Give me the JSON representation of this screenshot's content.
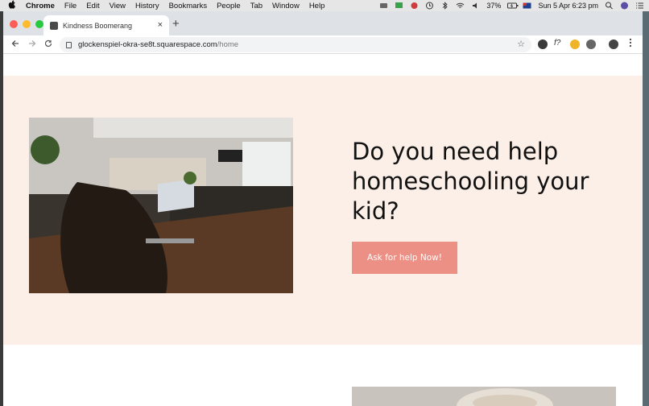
{
  "menubar": {
    "app": "Chrome",
    "items": [
      "File",
      "Edit",
      "View",
      "History",
      "Bookmarks",
      "People",
      "Tab",
      "Window",
      "Help"
    ],
    "battery": "37%",
    "datetime": "Sun 5 Apr  6:23 pm"
  },
  "browser": {
    "tab_title": "Kindness Boomerang",
    "url_host": "glockenspiel-okra-se8t.squarespace.com",
    "url_path": "/home",
    "new_tab_label": "+",
    "close_label": "×",
    "ext_f_label": "f?"
  },
  "hero": {
    "headline": "Do you need help homeschooling your kid?",
    "cta_label": "Ask for help Now!"
  },
  "colors": {
    "hero_bg": "#fcefe7",
    "cta_bg": "#ec8f84",
    "traffic_red": "#fc5f57",
    "traffic_yellow": "#fdbc2e",
    "traffic_green": "#28c840"
  }
}
